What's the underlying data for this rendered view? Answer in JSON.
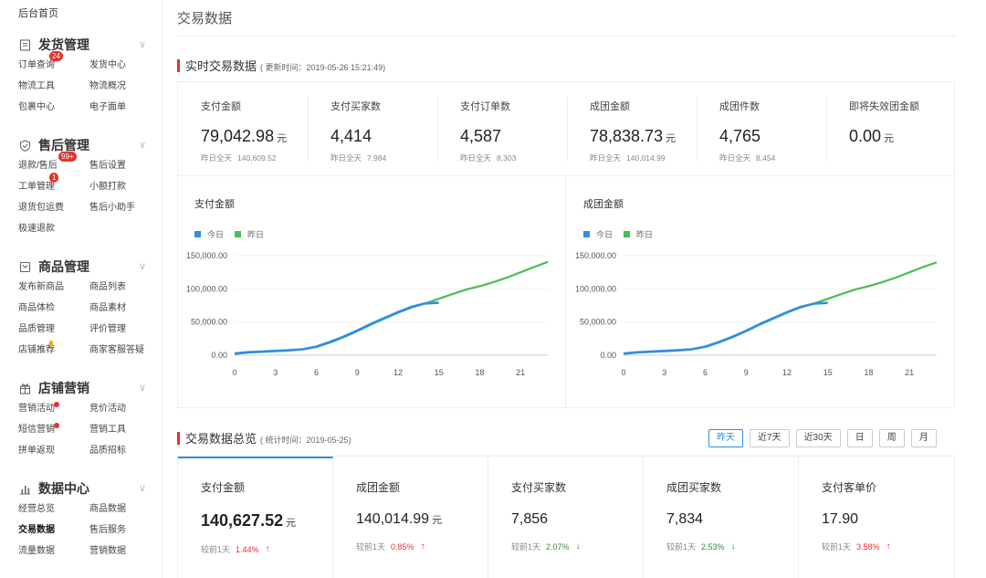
{
  "sidebar": {
    "home": "后台首页",
    "groups": [
      {
        "title": "发货管理",
        "icon": "document-icon",
        "items": [
          {
            "label": "订单查询",
            "badge": "24"
          },
          {
            "label": "发货中心"
          },
          {
            "label": "物流工具"
          },
          {
            "label": "物流概况"
          },
          {
            "label": "包裹中心"
          },
          {
            "label": "电子面单"
          }
        ]
      },
      {
        "title": "售后管理",
        "icon": "shield-check-icon",
        "items": [
          {
            "label": "退款/售后",
            "badge": "99+"
          },
          {
            "label": "售后设置"
          },
          {
            "label": "工单管理",
            "badge": "1"
          },
          {
            "label": "小额打款"
          },
          {
            "label": "退货包运费"
          },
          {
            "label": "售后小助手"
          },
          {
            "label": "极速退款"
          }
        ]
      },
      {
        "title": "商品管理",
        "icon": "box-icon",
        "items": [
          {
            "label": "发布新商品"
          },
          {
            "label": "商品列表"
          },
          {
            "label": "商品体检"
          },
          {
            "label": "商品素材"
          },
          {
            "label": "品质管理"
          },
          {
            "label": "评价管理"
          },
          {
            "label": "店铺推荐"
          },
          {
            "label": "商家客服答疑"
          }
        ]
      },
      {
        "title": "店铺营销",
        "icon": "gift-icon",
        "items": [
          {
            "label": "营销活动",
            "dot": true
          },
          {
            "label": "竞价活动"
          },
          {
            "label": "短信营销",
            "dot": true
          },
          {
            "label": "营销工具"
          },
          {
            "label": "拼单返现"
          },
          {
            "label": "品质招标"
          }
        ]
      },
      {
        "title": "数据中心",
        "icon": "bar-chart-icon",
        "items": [
          {
            "label": "经营总览"
          },
          {
            "label": "商品数据"
          },
          {
            "label": "交易数据",
            "active": true
          },
          {
            "label": "售后服务"
          },
          {
            "label": "流量数据"
          },
          {
            "label": "营销数据"
          }
        ]
      }
    ]
  },
  "page": {
    "title": "交易数据"
  },
  "realtime": {
    "title": "实时交易数据",
    "subtitle": "( 更新时间：2019-05-26 15:21:49)",
    "kpis": [
      {
        "label": "支付金额",
        "value": "79,042.98",
        "unit": "元",
        "yesterday_label": "昨日全天",
        "yesterday_value": "140,609.52"
      },
      {
        "label": "支付买家数",
        "value": "4,414",
        "unit": "",
        "yesterday_label": "昨日全天",
        "yesterday_value": "7,984"
      },
      {
        "label": "支付订单数",
        "value": "4,587",
        "unit": "",
        "yesterday_label": "昨日全天",
        "yesterday_value": "8,303"
      },
      {
        "label": "成团金额",
        "value": "78,838.73",
        "unit": "元",
        "yesterday_label": "昨日全天",
        "yesterday_value": "140,014.99"
      },
      {
        "label": "成团件数",
        "value": "4,765",
        "unit": "",
        "yesterday_label": "昨日全天",
        "yesterday_value": "8,454"
      },
      {
        "label": "即将失效团金额",
        "value": "0.00",
        "unit": "元",
        "yesterday_label": "",
        "yesterday_value": ""
      }
    ]
  },
  "colors": {
    "today": "#2f8de4",
    "yesterday": "#4cbb58",
    "accent": "#e5322d",
    "tab_active": "#2f8de4"
  },
  "chart_data": [
    {
      "type": "line",
      "title": "支付金额",
      "xticks": [
        0,
        3,
        6,
        9,
        12,
        15,
        18,
        21
      ],
      "yticks": [
        "0.00",
        "50,000.00",
        "100,000.00",
        "150,000.00"
      ],
      "xlim": [
        0,
        23
      ],
      "ylim": [
        0,
        150000
      ],
      "legend": "top-left",
      "series": [
        {
          "name": "今日",
          "x": [
            0,
            1,
            2,
            3,
            4,
            5,
            6,
            7,
            8,
            9,
            10,
            11,
            12,
            13,
            14,
            15
          ],
          "y": [
            2500,
            4500,
            5500,
            6500,
            7500,
            9000,
            13000,
            20000,
            28000,
            37000,
            47000,
            56000,
            65000,
            73000,
            78000,
            79043
          ]
        },
        {
          "name": "昨日",
          "x": [
            0,
            1,
            2,
            3,
            4,
            5,
            6,
            7,
            8,
            9,
            10,
            11,
            12,
            13,
            14,
            15,
            16,
            17,
            18,
            19,
            20,
            21,
            22,
            23
          ],
          "y": [
            2000,
            4000,
            5000,
            6000,
            7000,
            9000,
            12500,
            19000,
            27000,
            36000,
            46000,
            55000,
            64000,
            72000,
            78000,
            85000,
            92000,
            99000,
            104000,
            110000,
            117000,
            125000,
            133000,
            140610
          ]
        }
      ]
    },
    {
      "type": "line",
      "title": "成团金额",
      "xticks": [
        0,
        3,
        6,
        9,
        12,
        15,
        18,
        21
      ],
      "yticks": [
        "0.00",
        "50,000.00",
        "100,000.00",
        "150,000.00"
      ],
      "xlim": [
        0,
        23
      ],
      "ylim": [
        0,
        150000
      ],
      "legend": "top-left",
      "series": [
        {
          "name": "今日",
          "x": [
            0,
            1,
            2,
            3,
            4,
            5,
            6,
            7,
            8,
            9,
            10,
            11,
            12,
            13,
            14,
            15
          ],
          "y": [
            2500,
            4400,
            5400,
            6400,
            7400,
            8900,
            12900,
            19800,
            27800,
            36800,
            46800,
            55800,
            64800,
            72800,
            77800,
            78839
          ]
        },
        {
          "name": "昨日",
          "x": [
            0,
            1,
            2,
            3,
            4,
            5,
            6,
            7,
            8,
            9,
            10,
            11,
            12,
            13,
            14,
            15,
            16,
            17,
            18,
            19,
            20,
            21,
            22,
            23
          ],
          "y": [
            2000,
            4000,
            5000,
            6000,
            7000,
            9000,
            12500,
            19000,
            27000,
            36000,
            46000,
            55000,
            64000,
            72000,
            78000,
            85000,
            92000,
            99000,
            104000,
            110000,
            117000,
            125000,
            133000,
            140015
          ]
        }
      ]
    }
  ],
  "overview": {
    "title": "交易数据总览",
    "subtitle": "( 统计时间：2019-05-25)",
    "tabs": [
      "昨天",
      "近7天",
      "近30天",
      "日",
      "周",
      "月"
    ],
    "active_tab": 0,
    "cards": [
      {
        "label": "支付金额",
        "value": "140,627.52",
        "unit": "元",
        "cmp_label": "较前1天",
        "pct": "1.44%",
        "dir": "up"
      },
      {
        "label": "成团金额",
        "value": "140,014.99",
        "unit": "元",
        "cmp_label": "较前1天",
        "pct": "0.85%",
        "dir": "up"
      },
      {
        "label": "支付买家数",
        "value": "7,856",
        "unit": "",
        "cmp_label": "较前1天",
        "pct": "2.07%",
        "dir": "down"
      },
      {
        "label": "成团买家数",
        "value": "7,834",
        "unit": "",
        "cmp_label": "较前1天",
        "pct": "2.53%",
        "dir": "down"
      },
      {
        "label": "支付客单价",
        "value": "17.90",
        "unit": "",
        "cmp_label": "较前1天",
        "pct": "3.58%",
        "dir": "up"
      }
    ]
  }
}
